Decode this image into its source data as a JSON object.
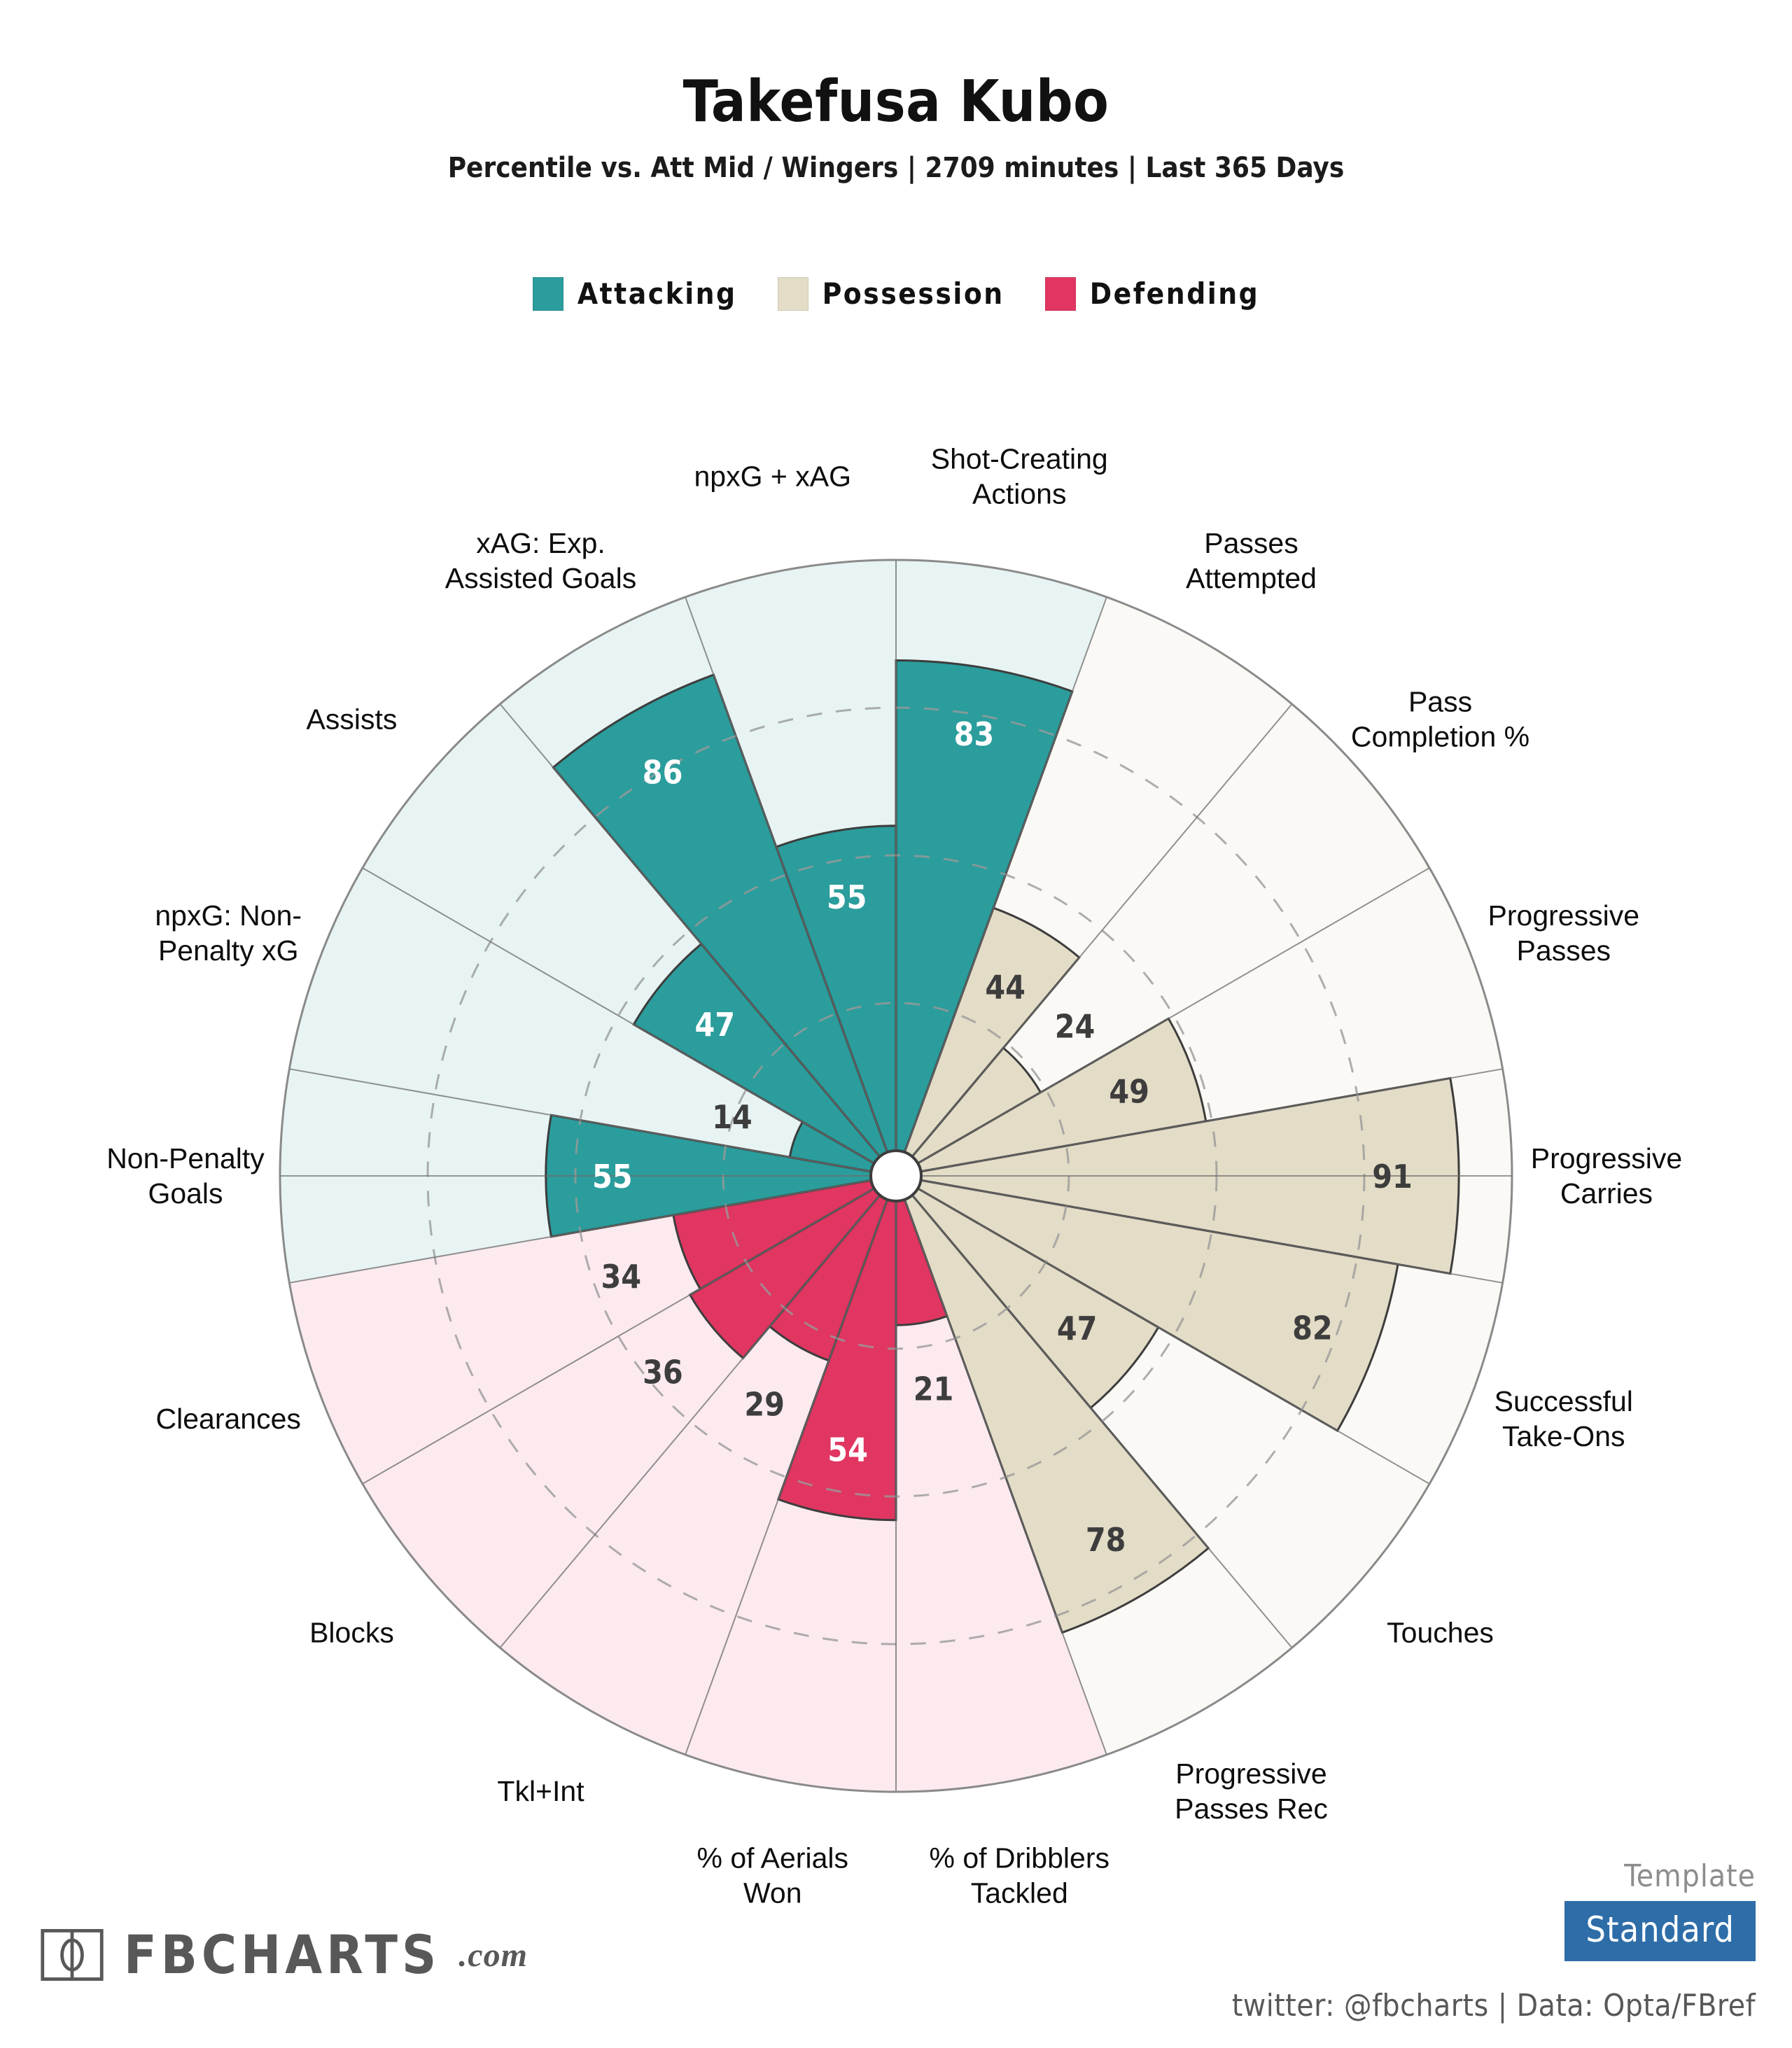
{
  "header": {
    "title": "Takefusa Kubo",
    "subtitle": "Percentile vs. Att Mid / Wingers | 2709 minutes | Last 365 Days"
  },
  "legend": [
    {
      "label": "Attacking",
      "color": "#2A9D9C"
    },
    {
      "label": "Possession",
      "color": "#E3DCC6"
    },
    {
      "label": "Defending",
      "color": "#E03661"
    }
  ],
  "colors": {
    "attacking": "#2A9D9C",
    "attacking_bg": "#E7F4F3",
    "possession": "#E3DCC6",
    "possession_bg": "#FAF9F5",
    "defending": "#E03661",
    "defending_bg": "#FCEAEF",
    "outline": "#3d3d3d",
    "grid": "#9a9a9a",
    "hub": "#ffffff",
    "template_badge": "#2E6DA8",
    "logo": "#585858"
  },
  "footer": {
    "logo_text": "FBCHARTS",
    "logo_suffix": ".com",
    "template_caption": "Template",
    "template_value": "Standard",
    "credit": "twitter: @fbcharts | Data: Opta/FBref"
  },
  "chart_data": {
    "type": "bar",
    "title": "Takefusa Kubo",
    "subtitle": "Percentile vs. Att Mid / Wingers | 2709 minutes | Last 365 Days",
    "variant": "polar-pizza",
    "ylim": [
      0,
      100
    ],
    "grid": true,
    "grid_rings": [
      25,
      50,
      75
    ],
    "start_angle_deg": -90,
    "direction": "clockwise",
    "legend_position": "top",
    "xlabel": "",
    "ylabel": "Percentile",
    "categories": [
      "Shot-Creating Actions",
      "Passes Attempted",
      "Pass Completion %",
      "Progressive Passes",
      "Progressive Carries",
      "Successful Take-Ons",
      "Touches",
      "Progressive Passes Rec",
      "% of Dribblers Tackled",
      "% of Aerials Won",
      "Tkl+Int",
      "Blocks",
      "Clearances",
      "Non-Penalty Goals",
      "npxG: Non-Penalty xG",
      "Assists",
      "xAG: Exp. Assisted Goals",
      "npxG + xAG"
    ],
    "values": [
      83,
      44,
      24,
      49,
      91,
      82,
      47,
      78,
      21,
      54,
      29,
      36,
      34,
      55,
      14,
      47,
      86,
      55
    ],
    "groups": [
      "Attacking",
      "Possession",
      "Possession",
      "Possession",
      "Possession",
      "Possession",
      "Possession",
      "Possession",
      "Defending",
      "Defending",
      "Defending",
      "Defending",
      "Defending",
      "Attacking",
      "Attacking",
      "Attacking",
      "Attacking",
      "Attacking"
    ],
    "slices": [
      {
        "label": "Shot-Creating Actions",
        "label_lines": [
          "Shot-Creating",
          "Actions"
        ],
        "value": 83,
        "group": "Attacking"
      },
      {
        "label": "Passes Attempted",
        "label_lines": [
          "Passes",
          "Attempted"
        ],
        "value": 44,
        "group": "Possession"
      },
      {
        "label": "Pass Completion %",
        "label_lines": [
          "Pass",
          "Completion %"
        ],
        "value": 24,
        "group": "Possession"
      },
      {
        "label": "Progressive Passes",
        "label_lines": [
          "Progressive",
          "Passes"
        ],
        "value": 49,
        "group": "Possession"
      },
      {
        "label": "Progressive Carries",
        "label_lines": [
          "Progressive",
          "Carries"
        ],
        "value": 91,
        "group": "Possession"
      },
      {
        "label": "Successful Take-Ons",
        "label_lines": [
          "Successful",
          "Take-Ons"
        ],
        "value": 82,
        "group": "Possession"
      },
      {
        "label": "Touches",
        "label_lines": [
          "Touches"
        ],
        "value": 47,
        "group": "Possession"
      },
      {
        "label": "Progressive Passes Rec",
        "label_lines": [
          "Progressive",
          "Passes Rec"
        ],
        "value": 78,
        "group": "Possession"
      },
      {
        "label": "% of Dribblers Tackled",
        "label_lines": [
          "% of Dribblers",
          "Tackled"
        ],
        "value": 21,
        "group": "Defending"
      },
      {
        "label": "% of Aerials Won",
        "label_lines": [
          "% of Aerials",
          "Won"
        ],
        "value": 54,
        "group": "Defending"
      },
      {
        "label": "Tkl+Int",
        "label_lines": [
          "Tkl+Int"
        ],
        "value": 29,
        "group": "Defending"
      },
      {
        "label": "Blocks",
        "label_lines": [
          "Blocks"
        ],
        "value": 36,
        "group": "Defending"
      },
      {
        "label": "Clearances",
        "label_lines": [
          "Clearances"
        ],
        "value": 34,
        "group": "Defending"
      },
      {
        "label": "Non-Penalty Goals",
        "label_lines": [
          "Non-Penalty",
          "Goals"
        ],
        "value": 55,
        "group": "Attacking"
      },
      {
        "label": "npxG: Non-Penalty xG",
        "label_lines": [
          "npxG: Non-",
          "Penalty xG"
        ],
        "value": 14,
        "group": "Attacking"
      },
      {
        "label": "Assists",
        "label_lines": [
          "Assists"
        ],
        "value": 47,
        "group": "Attacking"
      },
      {
        "label": "xAG: Exp. Assisted Goals",
        "label_lines": [
          "xAG: Exp.",
          "Assisted Goals"
        ],
        "value": 86,
        "group": "Attacking"
      },
      {
        "label": "npxG + xAG",
        "label_lines": [
          "npxG + xAG"
        ],
        "value": 55,
        "group": "Attacking"
      }
    ]
  }
}
